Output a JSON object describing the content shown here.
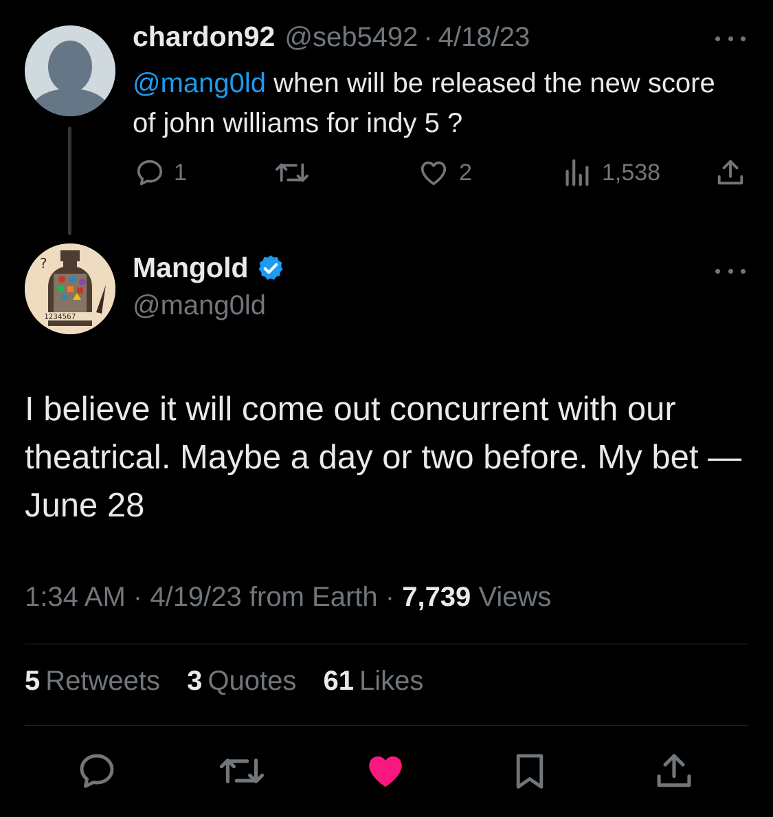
{
  "parent": {
    "author_name": "chardon92",
    "handle": "@seb5492",
    "date": "4/18/23",
    "mention": "@mang0ld",
    "text": " when will be released the new score of john williams for indy 5 ?",
    "actions": {
      "replies": "1",
      "likes": "2",
      "views": "1,538"
    }
  },
  "tweet": {
    "author_name": "Mangold",
    "handle": "@mang0ld",
    "verified": true,
    "text": "I believe it will come out concurrent with our theatrical. Maybe a day or two before. My bet — June 28",
    "time": "1:34 AM",
    "date": "4/19/23",
    "source": "from Earth",
    "views_count": "7,739",
    "views_label": "Views",
    "retweets_count": "5",
    "retweets_label": "Retweets",
    "quotes_count": "3",
    "quotes_label": "Quotes",
    "likes_count": "61",
    "likes_label": "Likes",
    "liked": true
  },
  "colors": {
    "background": "#000000",
    "text": "#e7e9ea",
    "muted": "#71767b",
    "link": "#1d9bf0",
    "like": "#f91880",
    "verified": "#1d9bf0",
    "divider": "#2f3336"
  },
  "icons": [
    "more-icon",
    "reply-icon",
    "retweet-icon",
    "like-icon",
    "views-icon",
    "share-icon",
    "verified-badge-icon",
    "bookmark-icon"
  ]
}
